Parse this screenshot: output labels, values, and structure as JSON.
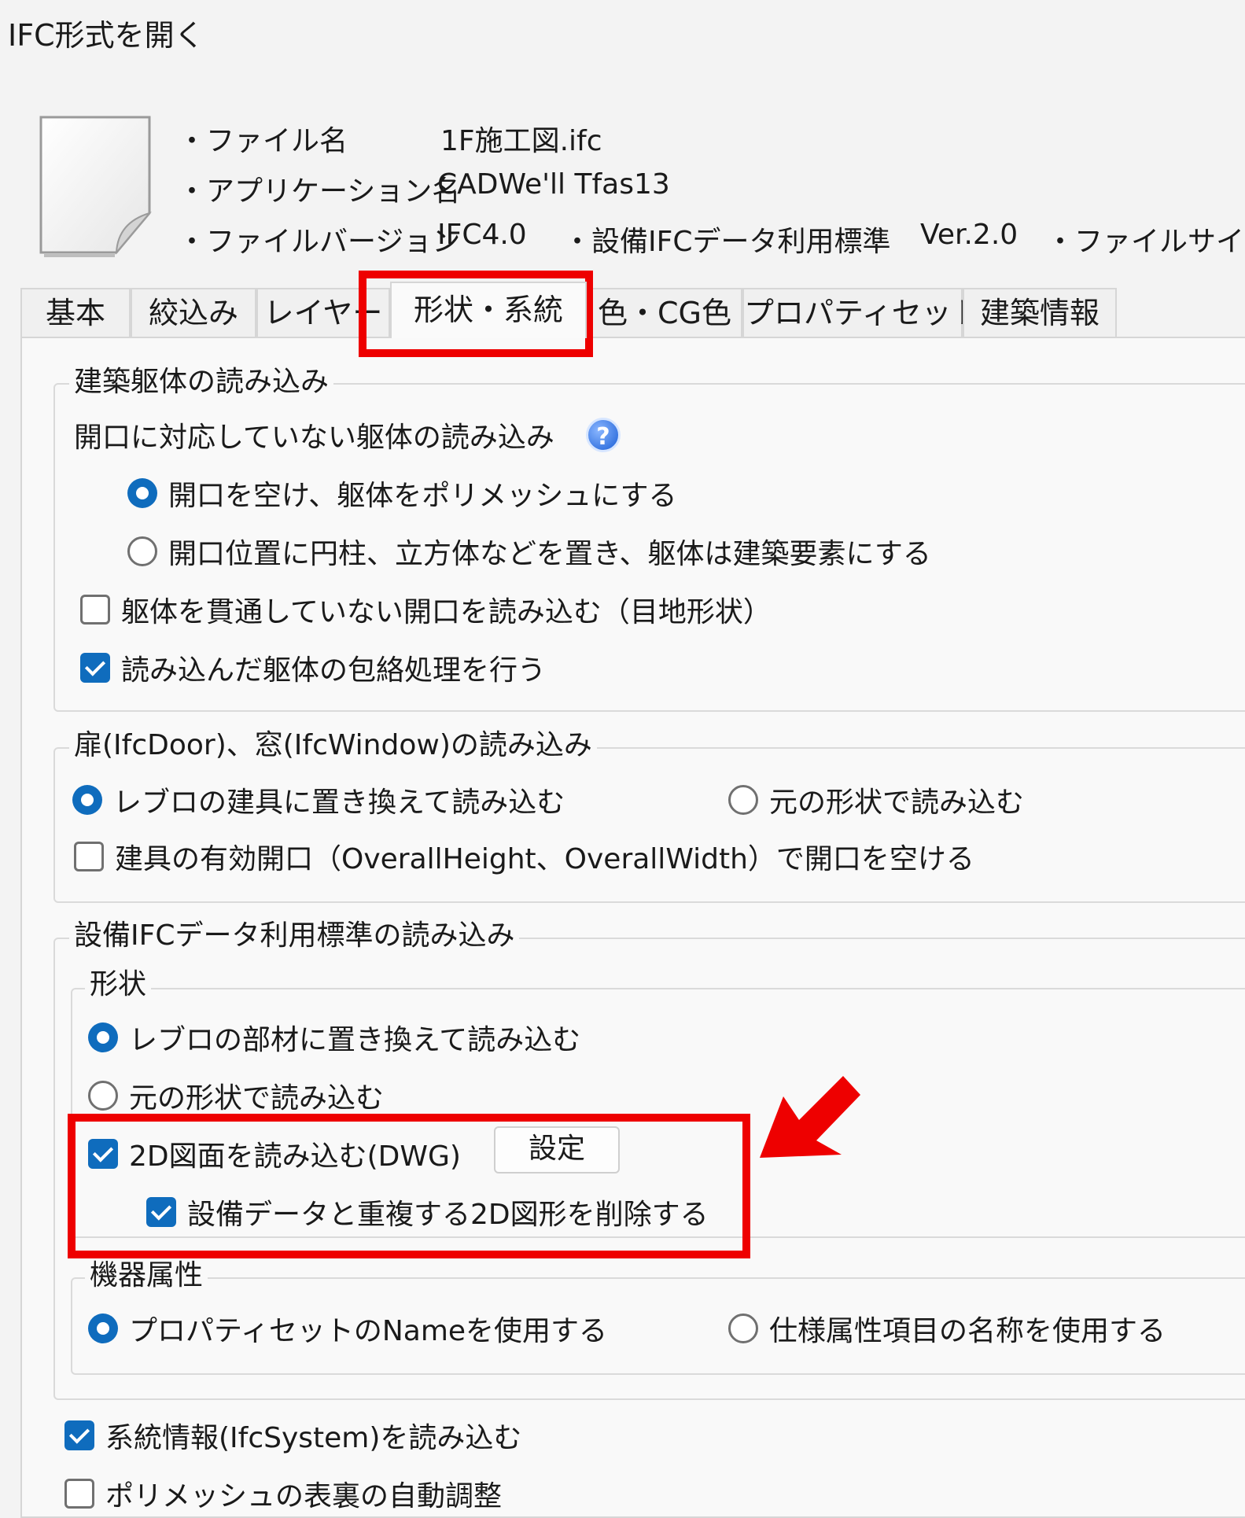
{
  "window": {
    "title": "IFC形式を開く"
  },
  "file_info": {
    "file_name_label": "・ファイル名",
    "file_name_value": "1F施工図.ifc",
    "application_label": "・アプリケーション名",
    "application_value": "CADWe'll Tfas13",
    "version_label": "・ファイルバージョン",
    "version_value": "IFC4.0",
    "standard_label": "・設備IFCデータ利用標準",
    "standard_value": "Ver.2.0",
    "file_size_label": "・ファイルサイズ"
  },
  "tabs": [
    "基本",
    "絞込み",
    "レイヤー",
    "形状・系統",
    "色・CG色",
    "プロパティセット",
    "建築情報"
  ],
  "active_tab": "形状・系統",
  "building_frame": {
    "title": "建築躯体の読み込み",
    "unsupported_label": "開口に対応していない躯体の読み込み",
    "help_icon": "question-icon",
    "options": [
      "開口を空け、躯体をポリメッシュにする",
      "開口位置に円柱、立方体などを置き、躯体は建築要素にする"
    ],
    "selected_option": 0,
    "checkbox_non_penetrating": "躯体を貫通していない開口を読み込む（目地形状）",
    "checkbox_non_penetrating_checked": false,
    "checkbox_envelope": "読み込んだ躯体の包絡処理を行う",
    "checkbox_envelope_checked": true
  },
  "door_window": {
    "title": "扉(IfcDoor)、窓(IfcWindow)の読み込み",
    "options": [
      "レブロの建具に置き換えて読み込む",
      "元の形状で読み込む"
    ],
    "selected_option": 0,
    "checkbox_opening": "建具の有効開口（OverallHeight、OverallWidth）で開口を空ける",
    "checkbox_opening_checked": false
  },
  "equipment": {
    "title": "設備IFCデータ利用標準の読み込み",
    "shape": {
      "title": "形状",
      "options": [
        "レブロの部材に置き換えて読み込む",
        "元の形状で読み込む"
      ],
      "selected_option": 0,
      "checkbox_2d": "2D図面を読み込む(DWG)",
      "checkbox_2d_checked": true,
      "settings_button": "設定",
      "checkbox_delete_dup": "設備データと重複する2D図形を削除する",
      "checkbox_delete_dup_checked": true
    },
    "attribute": {
      "title": "機器属性",
      "options": [
        "プロパティセットのNameを使用する",
        "仕様属性項目の名称を使用する"
      ],
      "selected_option": 0
    }
  },
  "bottom": {
    "checkbox_system": "系統情報(IfcSystem)を読み込む",
    "checkbox_system_checked": true,
    "checkbox_polymesh": "ポリメッシュの表裏の自動調整",
    "checkbox_polymesh_checked": false
  },
  "highlight_color": "#ee0000",
  "accent_color": "#0f6cbd"
}
